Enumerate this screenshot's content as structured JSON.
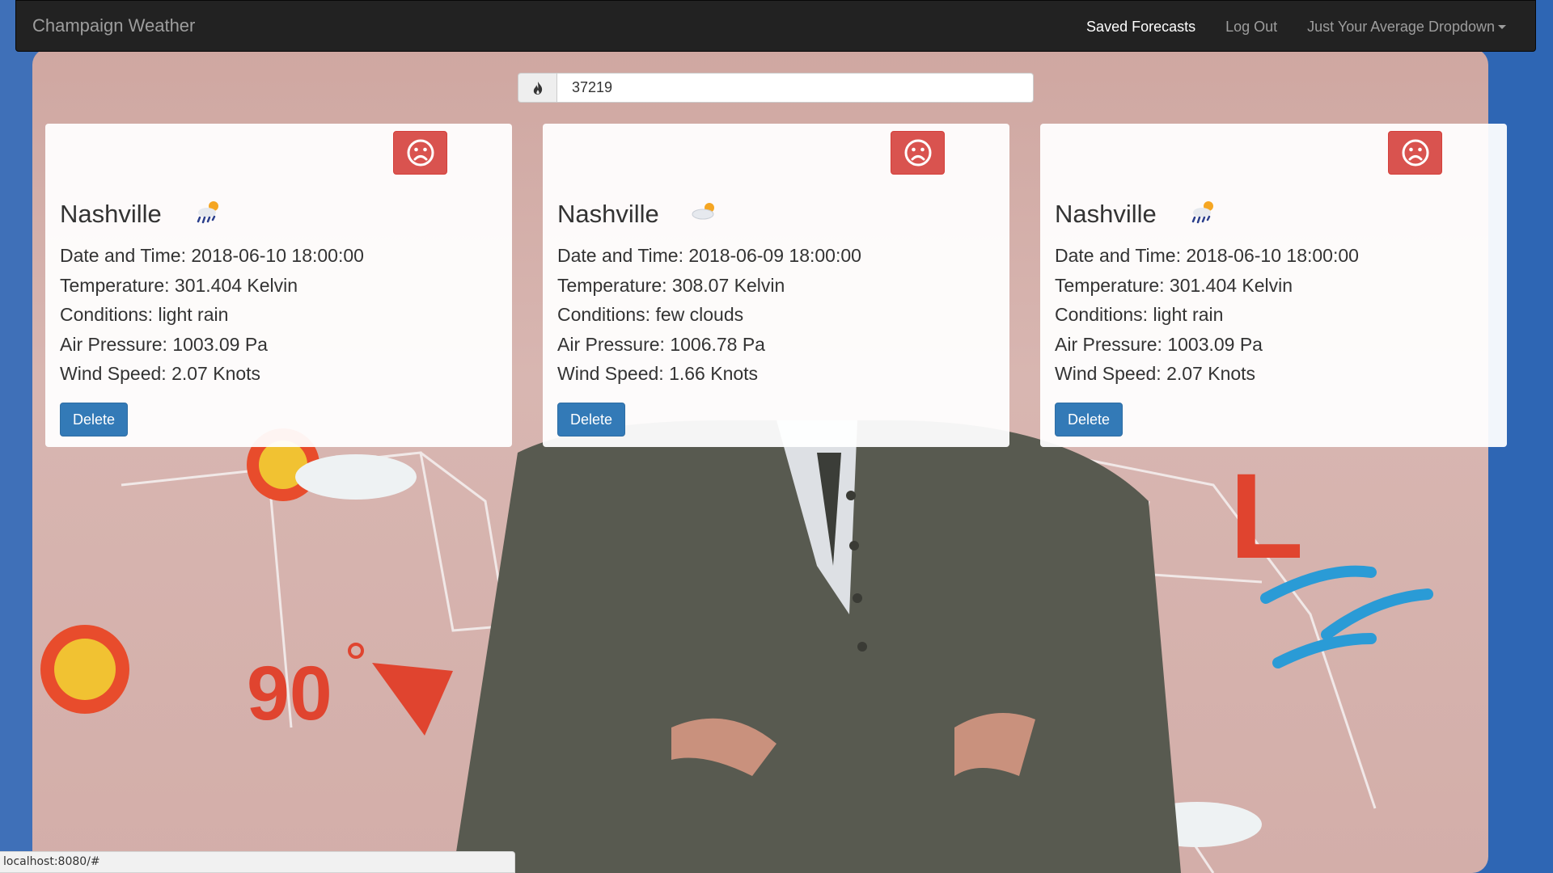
{
  "navbar": {
    "brand": "Champaign Weather",
    "links": [
      {
        "label": "Saved Forecasts",
        "active": true
      },
      {
        "label": "Log Out",
        "active": false
      },
      {
        "label": "Just Your Average Dropdown",
        "active": false
      }
    ]
  },
  "search": {
    "icon": "fire-icon",
    "value": "37219"
  },
  "forecasts": [
    {
      "city": "Nashville",
      "icon": "light-rain-icon",
      "date_time": "Date and Time: 2018-06-10 18:00:00",
      "temperature": "Temperature: 301.404 Kelvin",
      "conditions": "Conditions: light rain",
      "air_pressure": "Air Pressure: 1003.09 Pa",
      "wind_speed": "Wind Speed: 2.07 Knots",
      "delete_label": "Delete",
      "feedback_icon": "sad-face-icon"
    },
    {
      "city": "Nashville",
      "icon": "few-clouds-icon",
      "date_time": "Date and Time: 2018-06-09 18:00:00",
      "temperature": "Temperature: 308.07 Kelvin",
      "conditions": "Conditions: few clouds",
      "air_pressure": "Air Pressure: 1006.78 Pa",
      "wind_speed": "Wind Speed: 1.66 Knots",
      "delete_label": "Delete",
      "feedback_icon": "sad-face-icon"
    },
    {
      "city": "Nashville",
      "icon": "light-rain-icon",
      "date_time": "Date and Time: 2018-06-10 18:00:00",
      "temperature": "Temperature: 301.404 Kelvin",
      "conditions": "Conditions: light rain",
      "air_pressure": "Air Pressure: 1003.09 Pa",
      "wind_speed": "Wind Speed: 2.07 Knots",
      "delete_label": "Delete",
      "feedback_icon": "sad-face-icon"
    }
  ],
  "status_bar": {
    "url": "localhost:8080/#"
  },
  "colors": {
    "navbar_bg": "#222222",
    "danger": "#d9534f",
    "primary": "#337ab7"
  }
}
